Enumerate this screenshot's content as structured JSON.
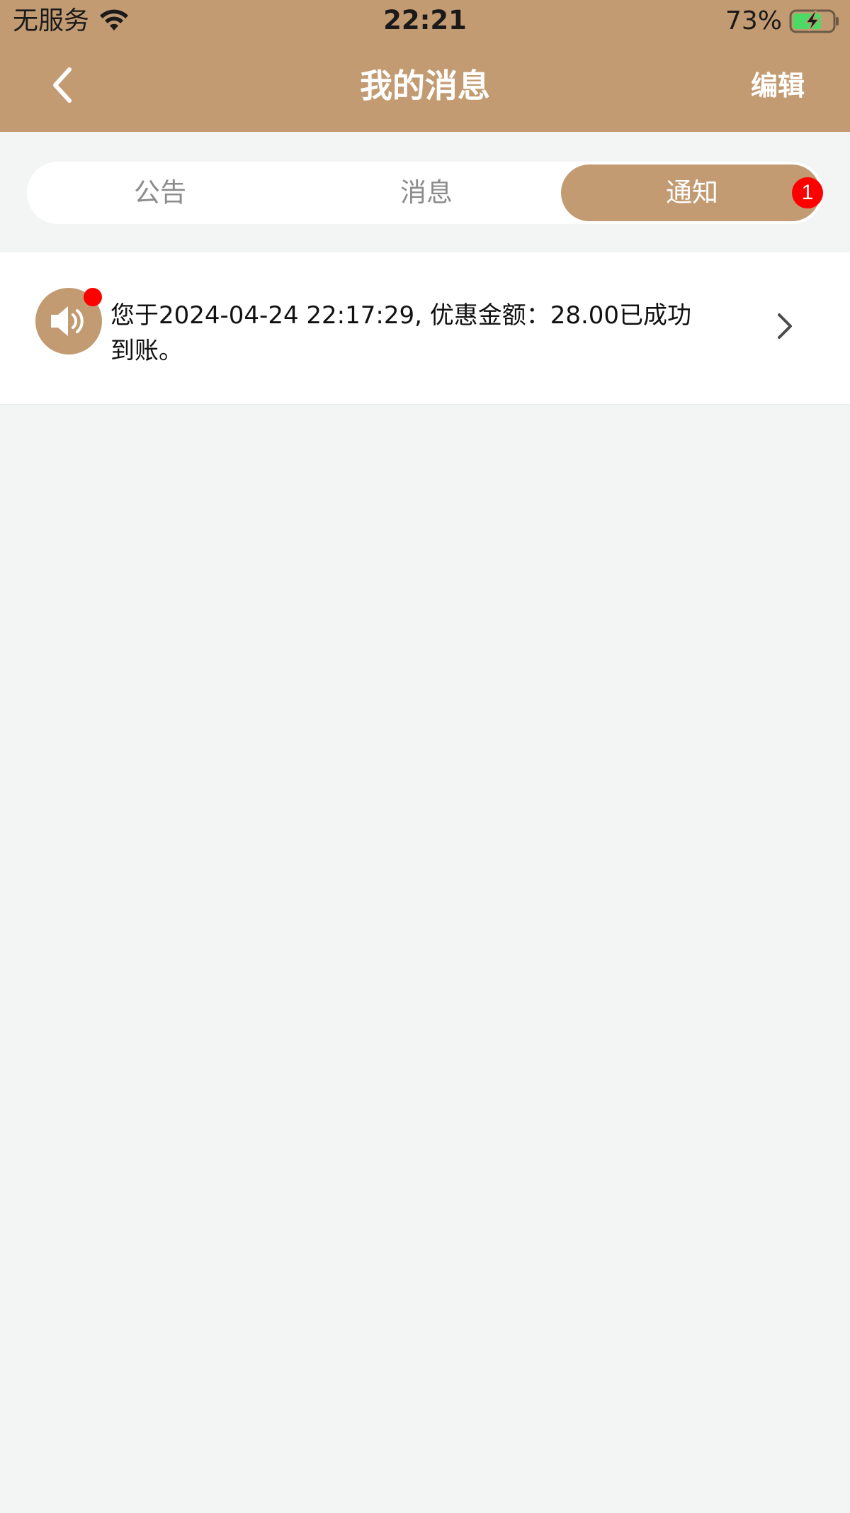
{
  "status_bar": {
    "carrier": "无服务",
    "time": "22:21",
    "battery_percent": "73%",
    "battery_level": 0.73,
    "charging": true
  },
  "nav": {
    "title": "我的消息",
    "edit_label": "编辑",
    "back_icon": "chevron-left-icon"
  },
  "tabs": {
    "items": [
      {
        "label": "公告",
        "selected": false
      },
      {
        "label": "消息",
        "selected": false
      },
      {
        "label": "通知",
        "selected": true,
        "badge": "1"
      }
    ]
  },
  "notifications": [
    {
      "icon": "speaker-icon",
      "unread": true,
      "text": "您于2024-04-24 22:17:29, 优惠金额：28.00已成功到账。"
    }
  ],
  "colors": {
    "accent": "#c39b72",
    "badge": "#ff0000",
    "background": "#f3f5f5",
    "battery_fill": "#4cd964"
  }
}
